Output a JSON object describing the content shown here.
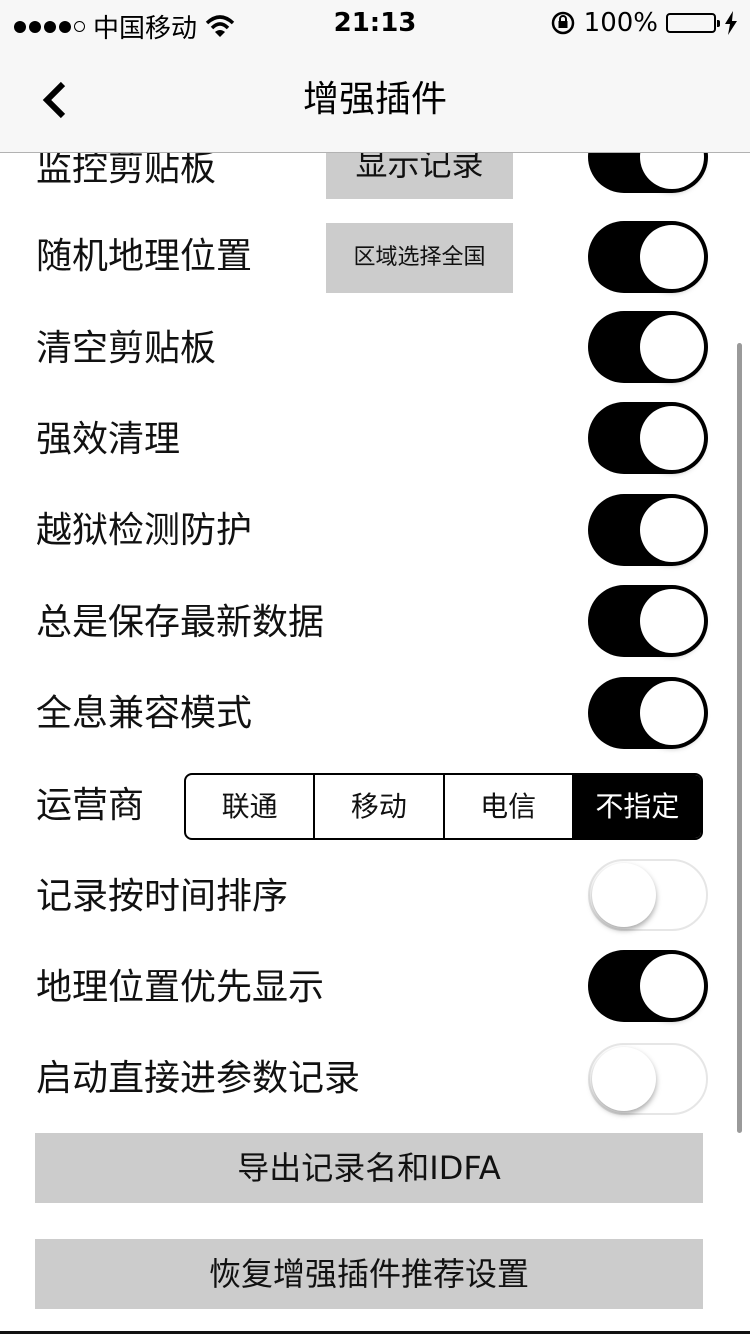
{
  "status_bar": {
    "carrier": "中国移动",
    "time": "21:13",
    "battery": "100%",
    "signal_icon": "signal-dots-icon",
    "wifi_icon": "wifi-icon",
    "lock_icon": "rotation-lock-icon",
    "battery_icon": "battery-icon",
    "charging_icon": "charging-bolt-icon",
    "battery_color": "#4cd964"
  },
  "nav": {
    "title": "增强插件",
    "back_icon": "chevron-left-icon"
  },
  "settings": [
    {
      "label": "监控剪贴板",
      "button": "显示记录",
      "toggle_on": true
    },
    {
      "label": "随机地理位置",
      "button": "区域选择全国",
      "toggle_on": true
    },
    {
      "label": "清空剪贴板",
      "toggle_on": true
    },
    {
      "label": "强效清理",
      "toggle_on": true
    },
    {
      "label": "越狱检测防护",
      "toggle_on": true
    },
    {
      "label": "总是保存最新数据",
      "toggle_on": true
    },
    {
      "label": "全息兼容模式",
      "toggle_on": true
    }
  ],
  "carrier_select": {
    "label": "运营商",
    "options": [
      "联通",
      "移动",
      "电信",
      "不指定"
    ],
    "selected": "不指定"
  },
  "settings_after": [
    {
      "label": "记录按时间排序",
      "toggle_on": false
    },
    {
      "label": "地理位置优先显示",
      "toggle_on": true
    },
    {
      "label": "启动直接进参数记录",
      "toggle_on": false
    }
  ],
  "actions": {
    "export_label": "导出记录名和IDFA",
    "restore_label": "恢复增强插件推荐设置"
  },
  "colors": {
    "toggle_on": "#000000",
    "button_bg": "#cccccc",
    "nav_bg": "#f7f7f7"
  }
}
